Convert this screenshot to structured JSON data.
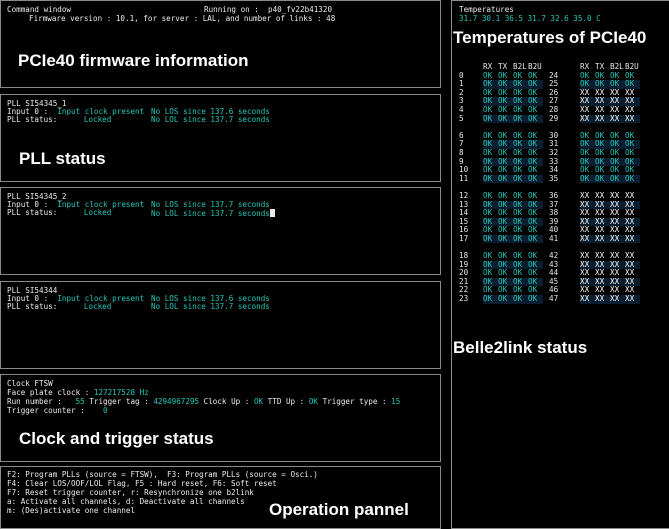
{
  "command_window": {
    "title": "Command window",
    "running_on": "Running on :  p40_fv22b41320",
    "firmware": "Firmware version : 10.1, for server : LAL, and number of links : 48",
    "annotation": "PCIe40 firmware information"
  },
  "pll1": {
    "title": "PLL SI54345_1",
    "input_label": "Input 0 :",
    "input_value": "Input clock present",
    "los": "No LOS since 137.6 seconds",
    "status_label": "PLL status:",
    "status_value": "Locked",
    "lol": "No LOL since 137.7 seconds",
    "annotation": "PLL status"
  },
  "pll2": {
    "title": "PLL SI54345_2",
    "input_label": "Input 0 :",
    "input_value": "Input clock present",
    "los": "No LOS since 137.7 seconds",
    "status_label": "PLL status:",
    "status_value": "Locked",
    "lol": "No LOL since 137.7 seconds"
  },
  "pll3": {
    "title": "PLL SI54344",
    "input_label": "Input 0 :",
    "input_value": "Input clock present",
    "los": "No LOS since 137.6 seconds",
    "status_label": "PLL status:",
    "status_value": "Locked",
    "lol": "No LOL since 137.7 seconds"
  },
  "clock": {
    "title": "Clock FTSW",
    "face_label": "Face plate clock :",
    "face_value": "127217528 Hz",
    "run_label": "Run number :",
    "run_value": "55",
    "tag_label": "Trigger tag :",
    "tag_value": "4294967295",
    "clockup_label": "Clock Up :",
    "clockup_value": "OK",
    "ttd_label": "TTD Up :",
    "ttd_value": "OK",
    "ttype_label": "Trigger type :",
    "ttype_value": "15",
    "counter_label": "Trigger counter :",
    "counter_value": "0",
    "annotation": "Clock and trigger status"
  },
  "operation": {
    "lines": [
      "F2: Program PLLs (source = FTSW),  F3: Program PLLs (source = Osci.)",
      "F4: Clear LOS/OOF/LOL Flag, F5 : Hard reset, F6: Soft reset",
      "F7: Reset trigger counter, r: Resynchronize one b2link",
      "a: Activate all channels, d: Deactivate all channels",
      "m: (Des)activate one channel"
    ],
    "annotation": "Operation pannel"
  },
  "temperatures": {
    "title": "Temperatures",
    "values": "31.7 30.1 36.5 31.7 32.6 35.0 C",
    "annotation": "Temperatures of PCIe40"
  },
  "belle2link": {
    "headers": [
      "RX",
      "TX",
      "B2L",
      "B2U"
    ],
    "ok_text": "OK",
    "bad_text": "XX",
    "left_indices": [
      0,
      1,
      2,
      3,
      4,
      5,
      6,
      7,
      8,
      9,
      10,
      11,
      12,
      13,
      14,
      15,
      16,
      17,
      18,
      19,
      20,
      21,
      22,
      23
    ],
    "right_status": [
      "OK",
      "OK",
      "XX",
      "XX",
      "XX",
      "XX",
      "OK",
      "OK",
      "OK",
      "OK",
      "OK",
      "OK",
      "XX",
      "XX",
      "XX",
      "XX",
      "XX",
      "XX",
      "XX",
      "XX",
      "XX",
      "XX",
      "XX",
      "XX"
    ],
    "annotation": "Belle2link status"
  },
  "colors": {
    "background": "#000000",
    "accent_cyan": "#24c7b8",
    "text": "#ececec",
    "panel_border": "#8a8a8a"
  }
}
